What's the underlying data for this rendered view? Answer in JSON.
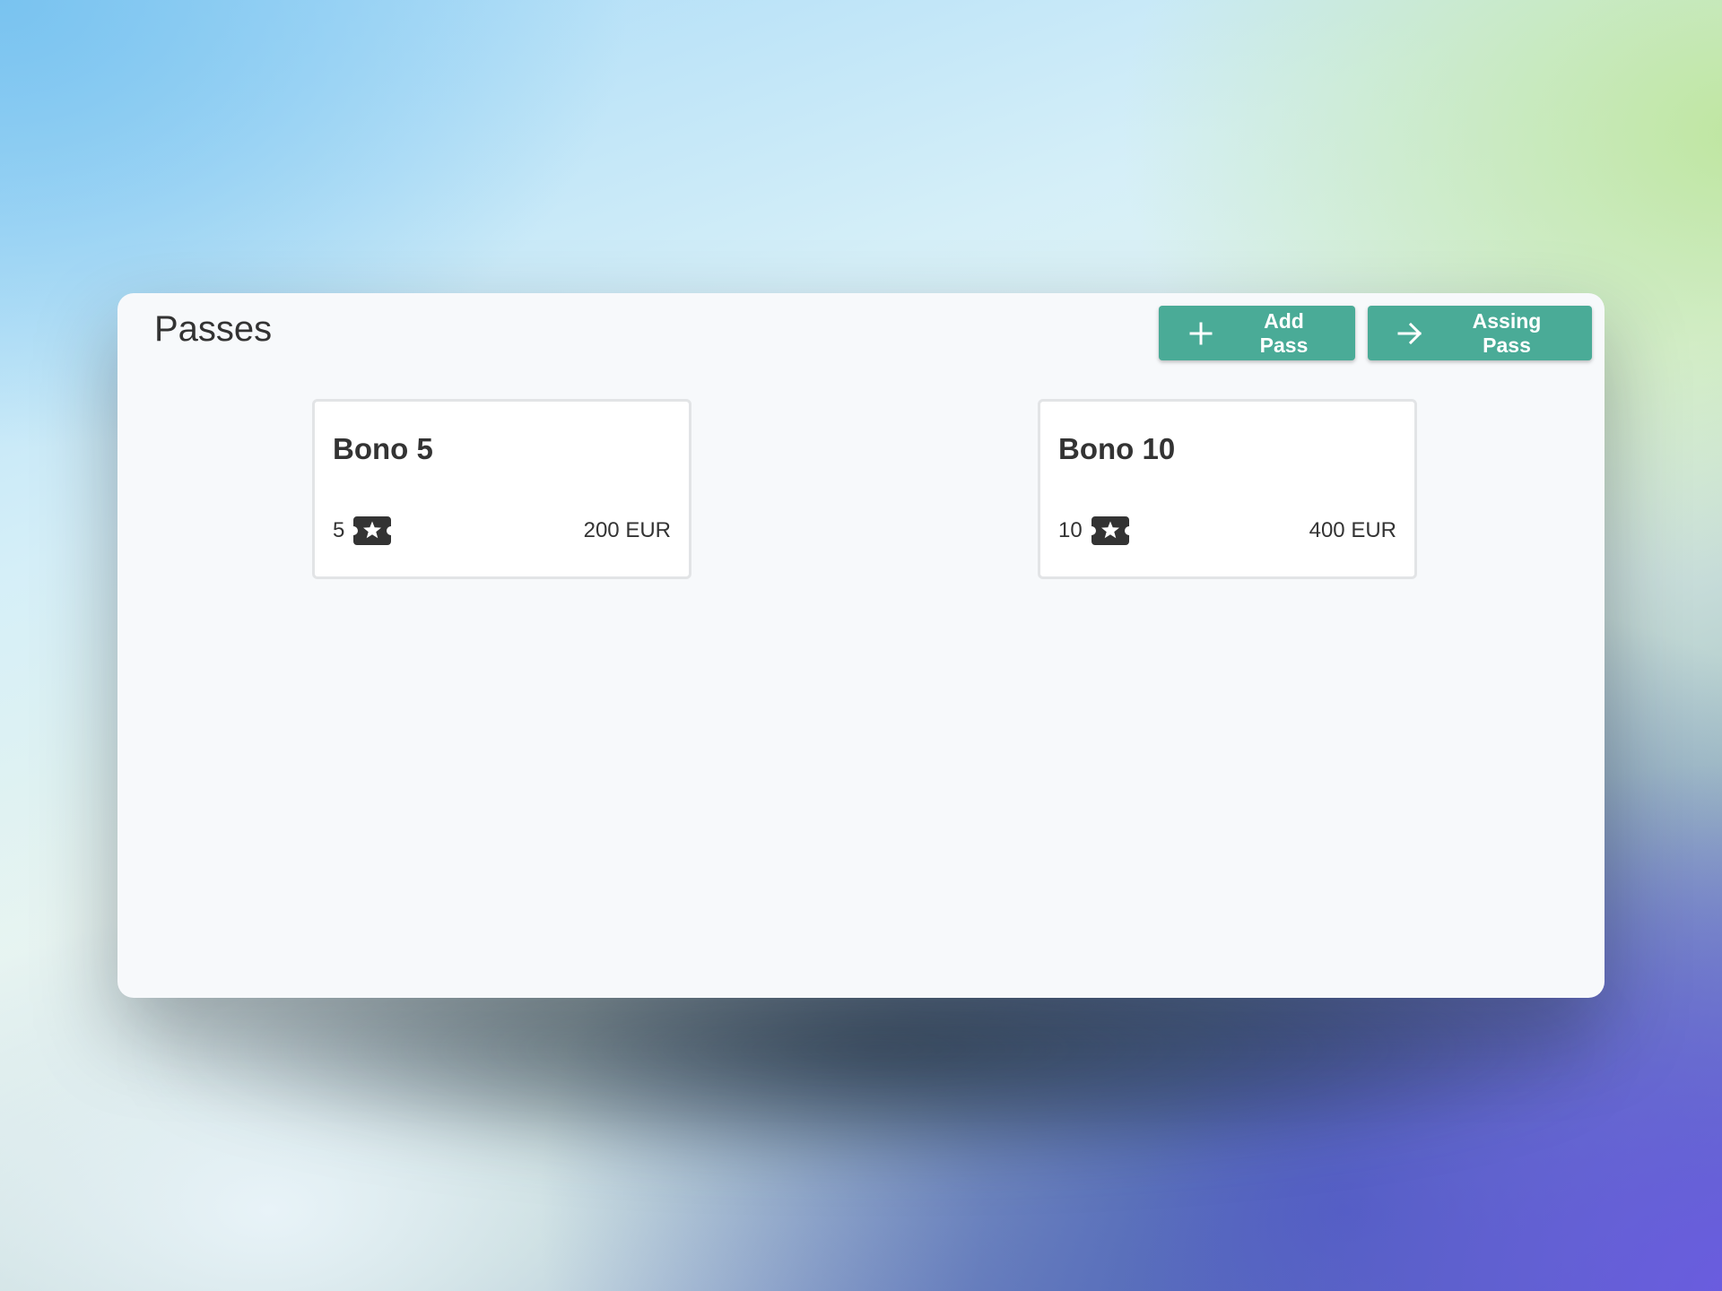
{
  "header": {
    "title": "Passes"
  },
  "toolbar": {
    "add_label": "Add Pass",
    "assign_label": "Assing Pass"
  },
  "passes": [
    {
      "name": "Bono 5",
      "uses": "5",
      "price": "200 EUR"
    },
    {
      "name": "Bono 10",
      "uses": "10",
      "price": "400 EUR"
    }
  ],
  "colors": {
    "accent": "#4aab97",
    "text": "#333333",
    "card_border": "#e2e4e6",
    "panel": "#f7f9fb"
  },
  "icons": {
    "add": "plus-icon",
    "assign": "arrow-right-icon",
    "uses": "ticket-star-icon"
  }
}
